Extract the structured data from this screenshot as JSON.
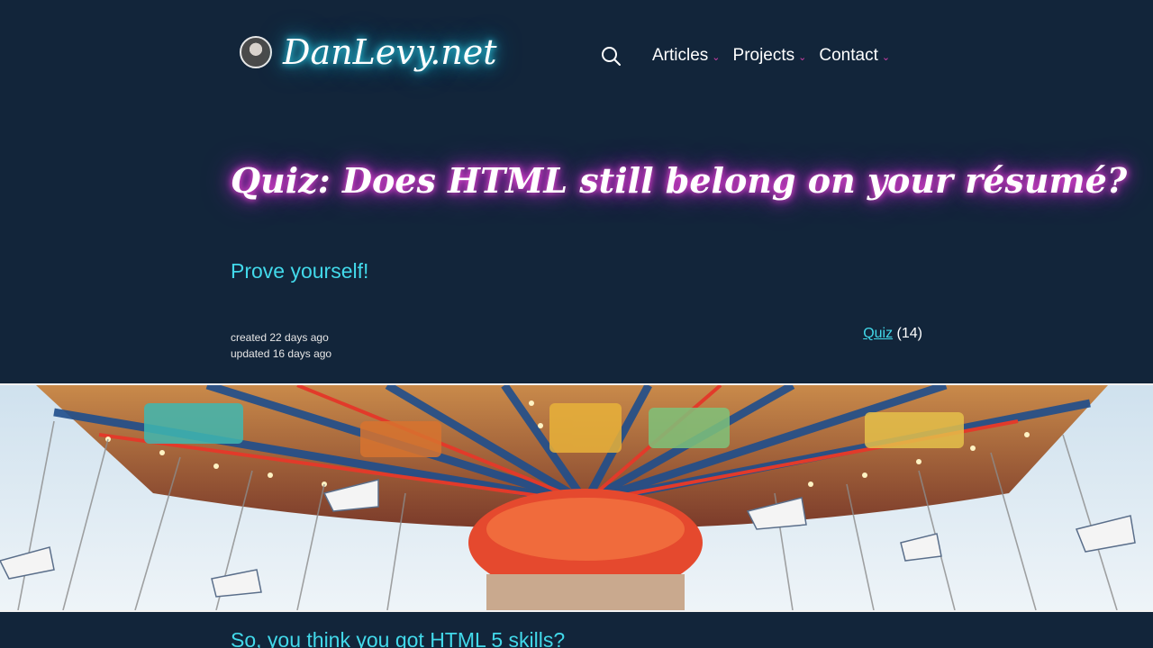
{
  "header": {
    "site_name": "DanLevy.net",
    "nav": [
      {
        "label": "Articles"
      },
      {
        "label": "Projects"
      },
      {
        "label": "Contact"
      }
    ]
  },
  "post": {
    "title": "Quiz: Does HTML still belong on your résumé?",
    "subtitle": "Prove yourself!",
    "created": "created 22 days ago",
    "updated": "updated 16 days ago",
    "tag_label": "Quiz",
    "tag_count": "(14)",
    "teaser": "So, you think you got HTML 5 skills?"
  },
  "colors": {
    "background": "#12253a",
    "accent_cyan": "#42d9ea",
    "accent_magenta": "#d13fa8"
  },
  "icons": [
    "avatar",
    "search-icon",
    "chevron-down-icon"
  ]
}
